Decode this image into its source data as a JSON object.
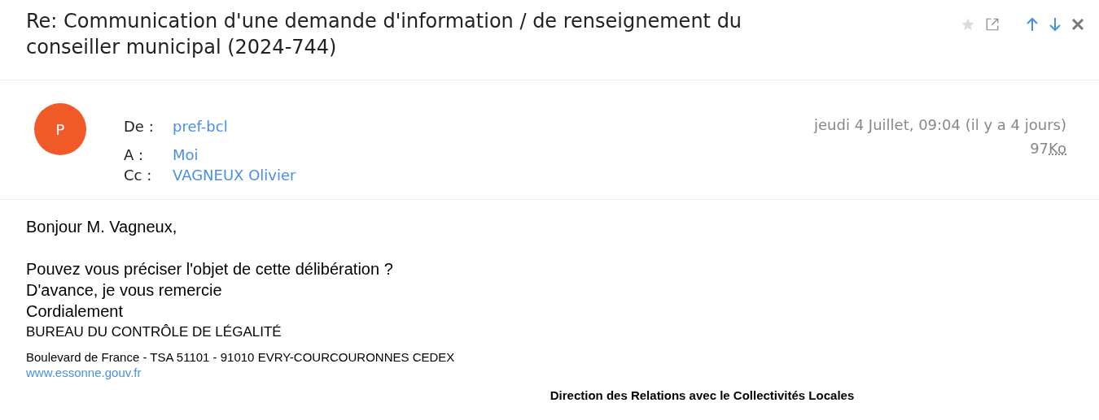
{
  "subject": "Re: Communication d'une demande d'information / de renseignement du conseiller municipal (2024-744)",
  "toolbar": {
    "starred": false
  },
  "sender": {
    "avatar_letter": "P"
  },
  "fields": [
    {
      "label": "De :",
      "value": "pref-bcl"
    },
    {
      "label": "A :",
      "value": "Moi"
    },
    {
      "label": "Cc :",
      "value": "VAGNEUX Olivier"
    }
  ],
  "date": "jeudi 4 Juillet, 09:04 (il y a 4 jours)",
  "size": {
    "number": "97",
    "unit": "Ko"
  },
  "body": [
    {
      "kind": "text",
      "text": "Bonjour M. Vagneux,"
    },
    {
      "kind": "gap"
    },
    {
      "kind": "text",
      "text": "Pouvez vous préciser l'objet de cette délibération ?"
    },
    {
      "kind": "text",
      "text": "D'avance, je vous remercie"
    },
    {
      "kind": "text",
      "text": "Cordialement"
    },
    {
      "kind": "heading",
      "text": "BUREAU DU CONTRÔLE DE LÉGALITÉ"
    },
    {
      "kind": "address",
      "text": "Boulevard de France - TSA 51101 - 91010 EVRY-COURCOURONNES CEDEX"
    },
    {
      "kind": "link",
      "text": "www.essonne.gouv.fr"
    },
    {
      "kind": "center",
      "text": "Direction des Relations avec le Collectivités Locales"
    }
  ]
}
